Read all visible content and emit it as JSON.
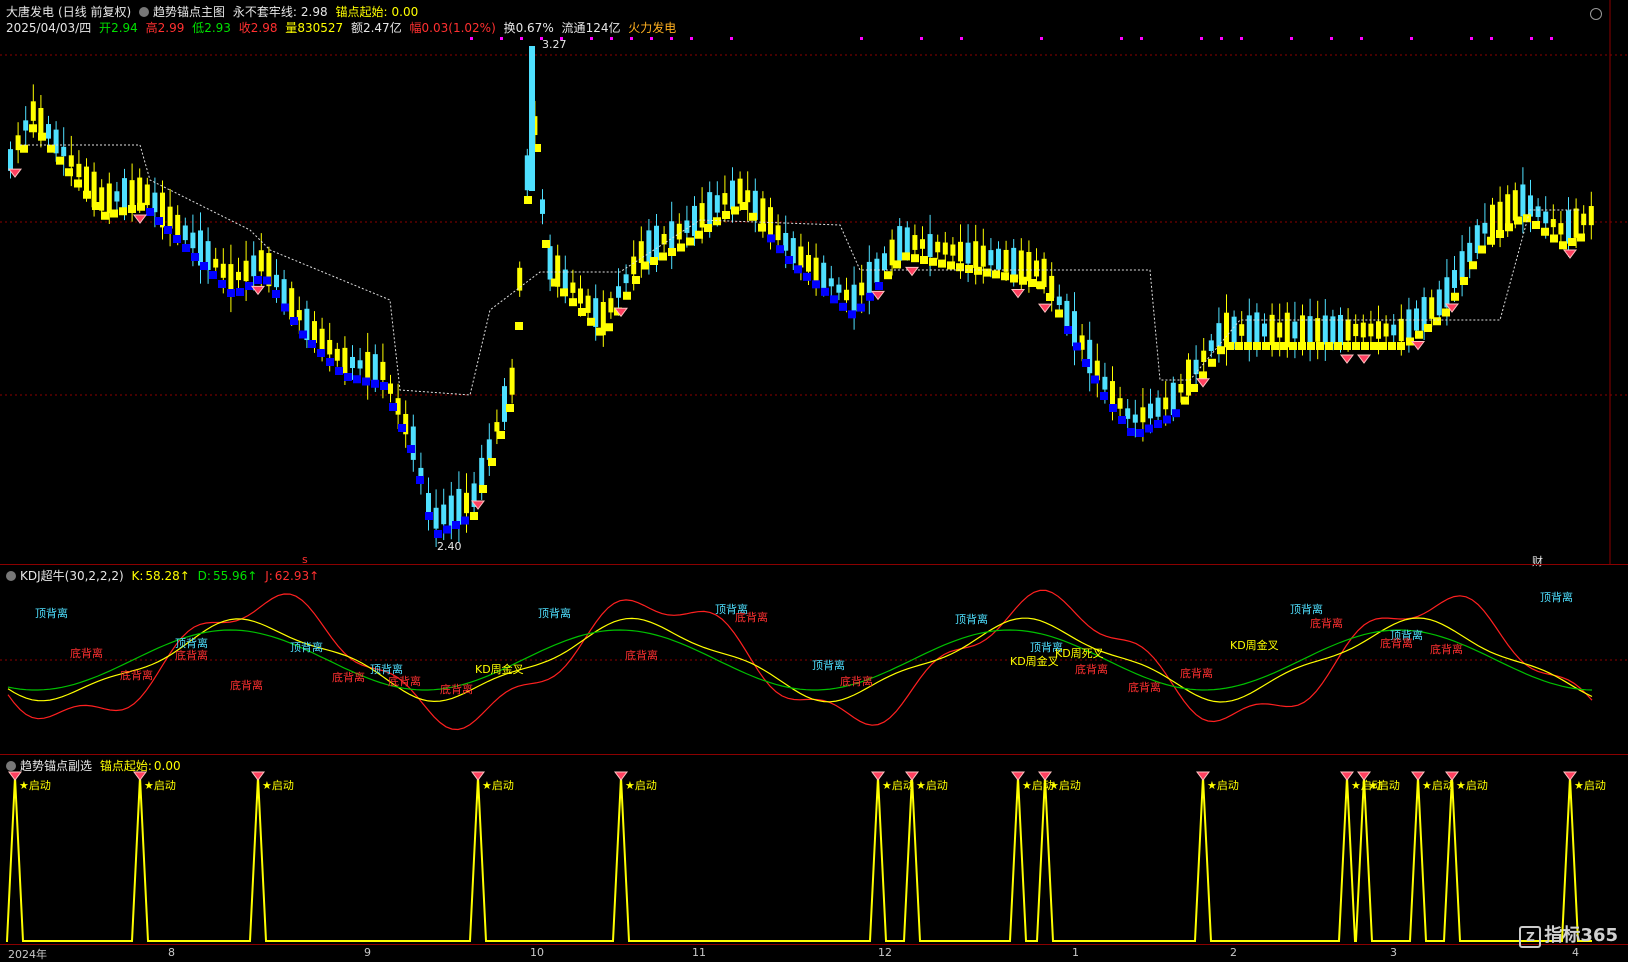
{
  "main": {
    "stock_name": "大唐发电",
    "period": "(日线 前复权)",
    "indicator": "趋势锚点主图",
    "line_label": "永不套牢线:",
    "line_value": "2.98",
    "anchor_label": "锚点起始:",
    "anchor_value": "0.00",
    "date": "2025/04/03/四",
    "open_label": "开",
    "open": "2.94",
    "high_label": "高",
    "high": "2.99",
    "low_label": "低",
    "low": "2.93",
    "close_label": "收",
    "close": "2.98",
    "vol_label": "量",
    "vol": "830527",
    "amount_label": "额",
    "amount": "2.47亿",
    "chg_label": "幅",
    "chg": "0.03(1.02%)",
    "turnover_label": "换",
    "turnover": "0.67%",
    "float_label": "流通",
    "float": "124亿",
    "sector": "火力发电",
    "max_label": "3.27",
    "min_label": "2.40",
    "marker_s": "s",
    "marker_cai": "财"
  },
  "kdj": {
    "title": "KDJ超牛(30,2,2,2)",
    "k_label": "K:",
    "k": "58.28↑",
    "d_label": "D:",
    "d": "55.96↑",
    "j_label": "J:",
    "j": "62.93↑",
    "labels": {
      "top": "顶背离",
      "bottom": "底背离",
      "kd_gold": "KD周金叉",
      "kd_dead": "KD周死叉"
    }
  },
  "sub": {
    "title": "趋势锚点副选",
    "anchor_label": "锚点起始:",
    "anchor_value": "0.00",
    "start_label": "★启动"
  },
  "axis": {
    "months": [
      "2024年",
      "8",
      "9",
      "10",
      "11",
      "12",
      "1",
      "2",
      "3",
      "4"
    ]
  },
  "brand": {
    "logo_text": "指标365",
    "logo_box": "Z"
  },
  "colors": {
    "up": "#4fe0ff",
    "down_fill": "#ffff00",
    "trend_blue": "#0000ff",
    "k_line": "#ffff00",
    "d_line": "#00c000",
    "j_line": "#ff2020",
    "grid": "#8b0000"
  }
}
